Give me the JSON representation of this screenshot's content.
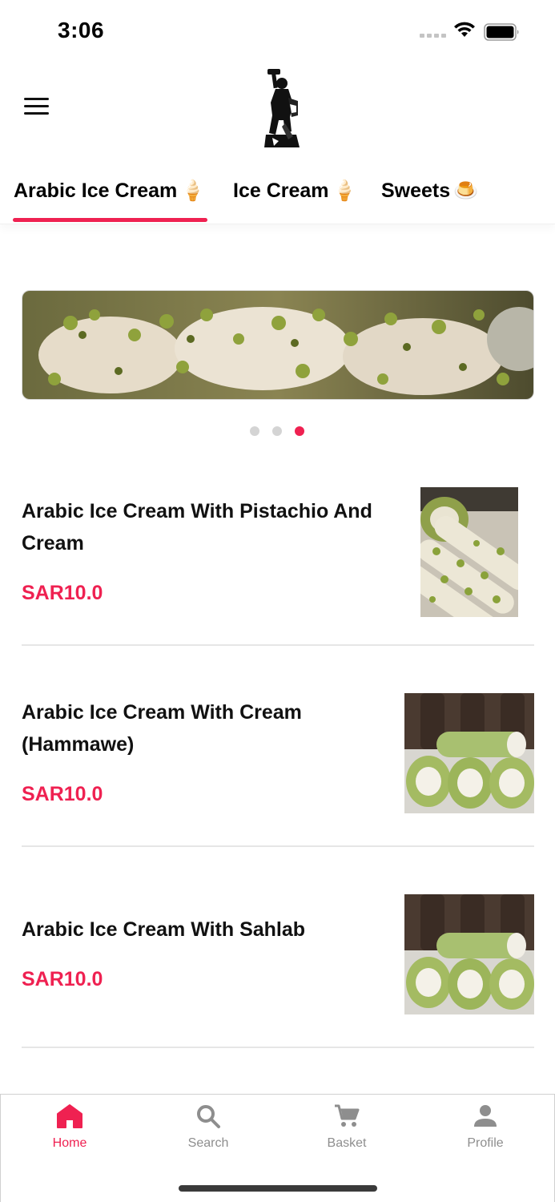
{
  "status_bar": {
    "time": "3:06",
    "icons": [
      "cellular-signal-icon",
      "wifi-icon",
      "battery-icon"
    ]
  },
  "header": {
    "menu_icon": "hamburger-menu-icon",
    "logo": "brand-logo"
  },
  "tabs": [
    {
      "label": "Arabic Ice Cream",
      "emoji": "🍦",
      "active": true
    },
    {
      "label": "Ice Cream",
      "emoji": "🍦",
      "active": false
    },
    {
      "label": "Sweets",
      "emoji": "🍮",
      "active": false
    }
  ],
  "banner": {
    "image": "pistachio-ice-cream-banner",
    "page_count": 3,
    "active_page": 3
  },
  "products": [
    {
      "name": "Arabic Ice Cream With Pistachio And Cream",
      "price": "SAR10.0",
      "image": "pistachio-roll-photo"
    },
    {
      "name": "Arabic Ice Cream With Cream (Hammawe)",
      "price": "SAR10.0",
      "image": "hammawe-roll-photo"
    },
    {
      "name": "Arabic Ice Cream With Sahlab",
      "price": "SAR10.0",
      "image": "sahlab-roll-photo"
    }
  ],
  "bottom_nav": [
    {
      "label": "Home",
      "icon": "home-icon",
      "active": true
    },
    {
      "label": "Search",
      "icon": "search-icon",
      "active": false
    },
    {
      "label": "Basket",
      "icon": "cart-icon",
      "active": false
    },
    {
      "label": "Profile",
      "icon": "person-icon",
      "active": false
    }
  ],
  "colors": {
    "accent": "#ef2151",
    "inactive": "#8e8e8e",
    "text": "#111111"
  }
}
